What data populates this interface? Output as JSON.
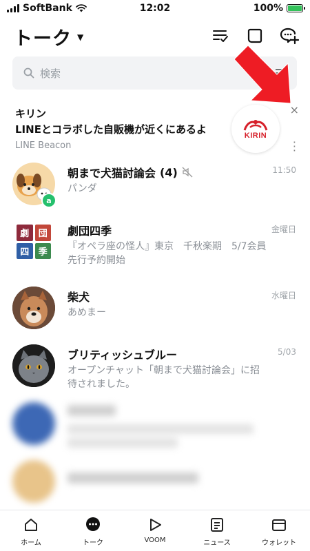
{
  "status_bar": {
    "carrier": "SoftBank",
    "time": "12:02",
    "battery": "100%",
    "battery_level": 1.0
  },
  "header": {
    "title": "トーク",
    "icons": [
      "list-check-icon",
      "new-chat-icon",
      "add-chat-icon"
    ]
  },
  "search": {
    "placeholder": "検索"
  },
  "beacon": {
    "title": "キリン",
    "message": "LINEとコラボした自販機が近くにあるよ",
    "source": "LINE Beacon",
    "logo_text": "KIRIN",
    "close": "×",
    "accent": "#d6202a"
  },
  "chats": [
    {
      "name": "朝まで犬猫討論会",
      "count": "(4)",
      "message": "パンダ",
      "time": "11:50",
      "muted": true
    },
    {
      "name": "劇団四季",
      "message": "『オペラ座の怪人』東京　千秋楽期　5/7会員先行予約開始",
      "time": "金曜日",
      "logo_chars": [
        "劇",
        "団",
        "四",
        "季"
      ]
    },
    {
      "name": "柴犬",
      "message": "あめまー",
      "time": "水曜日"
    },
    {
      "name": "ブリティッシュブルー",
      "message": "オープンチャット「朝まで犬猫討論会」に招待されました。",
      "time": "5/03"
    }
  ],
  "bottom_nav": [
    {
      "label": "ホーム",
      "icon": "home-icon"
    },
    {
      "label": "トーク",
      "icon": "talk-icon"
    },
    {
      "label": "VOOM",
      "icon": "voom-icon"
    },
    {
      "label": "ニュース",
      "icon": "news-icon"
    },
    {
      "label": "ウォレット",
      "icon": "wallet-icon"
    }
  ],
  "colors": {
    "accent_green": "#25c06d",
    "arrow_red": "#ee1c24"
  }
}
